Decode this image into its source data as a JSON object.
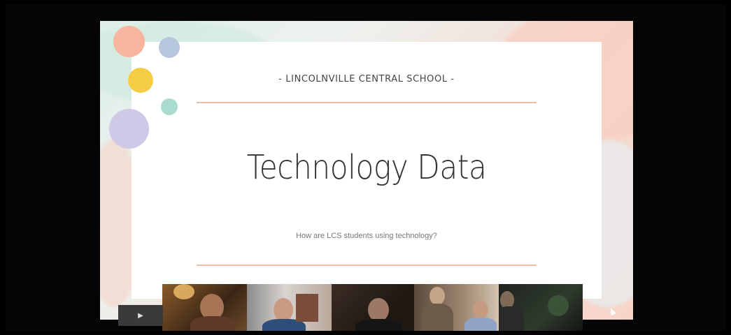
{
  "slide": {
    "school_name": "- LINCOLNVILLE CENTRAL SCHOOL -",
    "title": "Technology Data",
    "subtitle": "How are LCS students using technology?"
  },
  "decor_colors": [
    "#f7b5a0",
    "#b7c6dd",
    "#f5cd45",
    "#a9dccf",
    "#cfc8e6"
  ],
  "participants": [
    {
      "name": "participant-1"
    },
    {
      "name": "participant-2"
    },
    {
      "name": "participant-3"
    },
    {
      "name": "participant-4"
    },
    {
      "name": "participant-5"
    }
  ],
  "controls": {
    "play_icon": "play-icon"
  }
}
